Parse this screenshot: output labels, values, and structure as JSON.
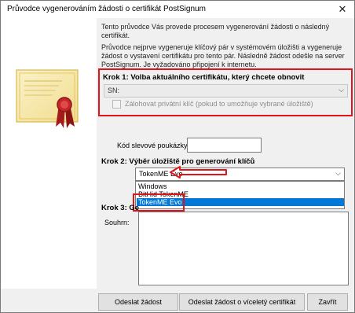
{
  "window": {
    "title": "Průvodce vygenerováním žádosti o certifikát PostSignum",
    "close_glyph": "✕"
  },
  "intro": {
    "line1": "Tento průvodce Vás provede procesem vygenerování žádosti o následný certifikát.",
    "line2": "Průvodce nejprve vygeneruje klíčový pár v systémovém úložišti a vygeneruje žádost o vystavení certifikátu pro tento pár. Následně žádost odešle na server PostSignum. Je vyžadováno připojení k internetu."
  },
  "step1": {
    "title": "Krok 1: Volba aktuálního certifikátu, který chcete obnovit",
    "sn_label": "SN:",
    "backup_label": "Zálohovat privátní klíč (pokud to umožňuje vybrané úložiště)"
  },
  "voucher": {
    "label": "Kód slevové poukázky:",
    "value": ""
  },
  "step2": {
    "title": "Krok 2: Výběr úložiště pro generování klíčů",
    "selected": "TokenME Evo",
    "options": [
      "Windows",
      "BitHid TokenME",
      "TokenME Evo"
    ]
  },
  "step3": {
    "title": "Krok 3: Ge",
    "summary_label": "Souhrn:",
    "summary_value": ""
  },
  "buttons": {
    "send": "Odeslat žádost",
    "send_multi": "Odeslat žádost o víceletý certifikát",
    "close": "Zavřít"
  },
  "colors": {
    "annotation_red": "#e0151b",
    "selection_blue": "#0078d7"
  },
  "icons": {
    "illustration": "certificate-icon",
    "close": "close-icon",
    "dropdown": "chevron-down-icon",
    "annotation": "arrow-left-icon"
  }
}
